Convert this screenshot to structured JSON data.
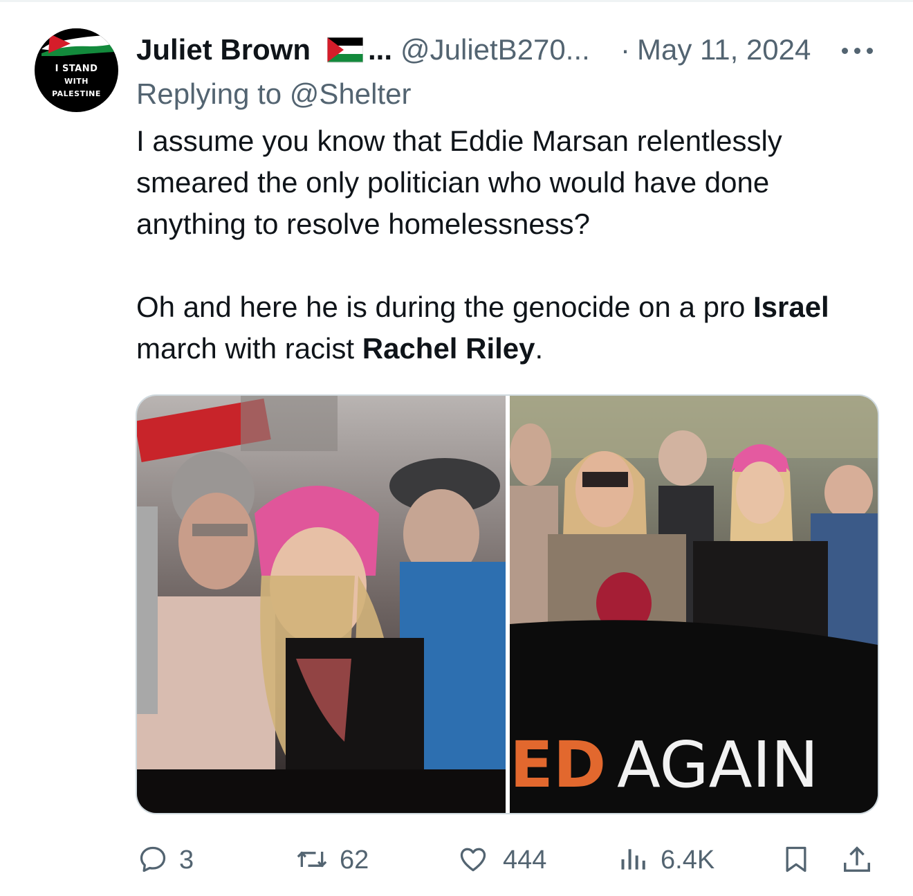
{
  "tweet": {
    "author_name": "Juliet Brown",
    "name_ellipsis": "...",
    "handle": "@JulietB270...",
    "separator": "·",
    "date": "May 11, 2024",
    "replying_label": "Replying to",
    "replying_handle": "@Shelter",
    "avatar_text": [
      "I STAND",
      "WITH",
      "PALESTINE"
    ],
    "text_p1": "I assume you know that Eddie Marsan relentlessly smeared the only politician who would have done anything to resolve homelessness?",
    "text_p2_a": "Oh and here he is during the genocide on a pro ",
    "text_p2_b": "Israel",
    "text_p2_c": " march with racist ",
    "text_p2_d": "Rachel Riley",
    "text_p2_e": ".",
    "image_banner_text_orange": "ED",
    "image_banner_text_white": "AGAIN"
  },
  "actions": {
    "replies": "3",
    "reposts": "62",
    "likes": "444",
    "views": "6.4K"
  },
  "icons": {
    "more": "more-icon",
    "reply": "reply-icon",
    "repost": "repost-icon",
    "like": "like-icon",
    "views": "views-icon",
    "bookmark": "bookmark-icon",
    "share": "share-icon"
  },
  "colors": {
    "text": "#0f1419",
    "secondary": "#536471",
    "border": "#cfd9de"
  }
}
